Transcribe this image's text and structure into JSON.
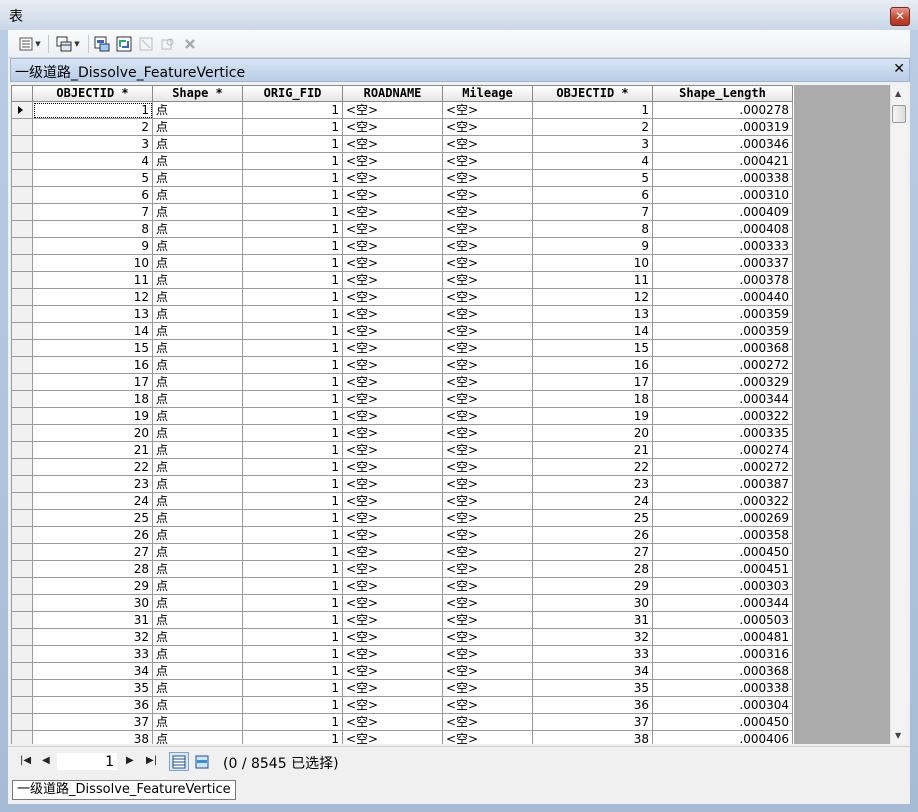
{
  "window": {
    "title": "表"
  },
  "toolbar": {
    "buttons": [
      "table-options-icon",
      "related-tables-icon",
      "select-by-attributes-icon",
      "switch-selection-icon",
      "clear-selection-icon",
      "zoom-to-selected-icon",
      "delete-selected-icon"
    ]
  },
  "table": {
    "caption": "一级道路_Dissolve_FeatureVertice",
    "columns": [
      "OBJECTID *",
      "Shape *",
      "ORIG_FID",
      "ROADNAME",
      "Mileage",
      "OBJECTID *",
      "Shape_Length"
    ],
    "rows": [
      [
        "1",
        "点",
        "1",
        "<空>",
        "<空>",
        "1",
        ".000278"
      ],
      [
        "2",
        "点",
        "1",
        "<空>",
        "<空>",
        "2",
        ".000319"
      ],
      [
        "3",
        "点",
        "1",
        "<空>",
        "<空>",
        "3",
        ".000346"
      ],
      [
        "4",
        "点",
        "1",
        "<空>",
        "<空>",
        "4",
        ".000421"
      ],
      [
        "5",
        "点",
        "1",
        "<空>",
        "<空>",
        "5",
        ".000338"
      ],
      [
        "6",
        "点",
        "1",
        "<空>",
        "<空>",
        "6",
        ".000310"
      ],
      [
        "7",
        "点",
        "1",
        "<空>",
        "<空>",
        "7",
        ".000409"
      ],
      [
        "8",
        "点",
        "1",
        "<空>",
        "<空>",
        "8",
        ".000408"
      ],
      [
        "9",
        "点",
        "1",
        "<空>",
        "<空>",
        "9",
        ".000333"
      ],
      [
        "10",
        "点",
        "1",
        "<空>",
        "<空>",
        "10",
        ".000337"
      ],
      [
        "11",
        "点",
        "1",
        "<空>",
        "<空>",
        "11",
        ".000378"
      ],
      [
        "12",
        "点",
        "1",
        "<空>",
        "<空>",
        "12",
        ".000440"
      ],
      [
        "13",
        "点",
        "1",
        "<空>",
        "<空>",
        "13",
        ".000359"
      ],
      [
        "14",
        "点",
        "1",
        "<空>",
        "<空>",
        "14",
        ".000359"
      ],
      [
        "15",
        "点",
        "1",
        "<空>",
        "<空>",
        "15",
        ".000368"
      ],
      [
        "16",
        "点",
        "1",
        "<空>",
        "<空>",
        "16",
        ".000272"
      ],
      [
        "17",
        "点",
        "1",
        "<空>",
        "<空>",
        "17",
        ".000329"
      ],
      [
        "18",
        "点",
        "1",
        "<空>",
        "<空>",
        "18",
        ".000344"
      ],
      [
        "19",
        "点",
        "1",
        "<空>",
        "<空>",
        "19",
        ".000322"
      ],
      [
        "20",
        "点",
        "1",
        "<空>",
        "<空>",
        "20",
        ".000335"
      ],
      [
        "21",
        "点",
        "1",
        "<空>",
        "<空>",
        "21",
        ".000274"
      ],
      [
        "22",
        "点",
        "1",
        "<空>",
        "<空>",
        "22",
        ".000272"
      ],
      [
        "23",
        "点",
        "1",
        "<空>",
        "<空>",
        "23",
        ".000387"
      ],
      [
        "24",
        "点",
        "1",
        "<空>",
        "<空>",
        "24",
        ".000322"
      ],
      [
        "25",
        "点",
        "1",
        "<空>",
        "<空>",
        "25",
        ".000269"
      ],
      [
        "26",
        "点",
        "1",
        "<空>",
        "<空>",
        "26",
        ".000358"
      ],
      [
        "27",
        "点",
        "1",
        "<空>",
        "<空>",
        "27",
        ".000450"
      ],
      [
        "28",
        "点",
        "1",
        "<空>",
        "<空>",
        "28",
        ".000451"
      ],
      [
        "29",
        "点",
        "1",
        "<空>",
        "<空>",
        "29",
        ".000303"
      ],
      [
        "30",
        "点",
        "1",
        "<空>",
        "<空>",
        "30",
        ".000344"
      ],
      [
        "31",
        "点",
        "1",
        "<空>",
        "<空>",
        "31",
        ".000503"
      ],
      [
        "32",
        "点",
        "1",
        "<空>",
        "<空>",
        "32",
        ".000481"
      ],
      [
        "33",
        "点",
        "1",
        "<空>",
        "<空>",
        "33",
        ".000316"
      ],
      [
        "34",
        "点",
        "1",
        "<空>",
        "<空>",
        "34",
        ".000368"
      ],
      [
        "35",
        "点",
        "1",
        "<空>",
        "<空>",
        "35",
        ".000338"
      ],
      [
        "36",
        "点",
        "1",
        "<空>",
        "<空>",
        "36",
        ".000304"
      ],
      [
        "37",
        "点",
        "1",
        "<空>",
        "<空>",
        "37",
        ".000450"
      ],
      [
        "38",
        "点",
        "1",
        "<空>",
        "<空>",
        "38",
        ".000406"
      ]
    ]
  },
  "navigation": {
    "current_record": "1",
    "selection_status": "(0 / 8545 已选择)"
  },
  "tabs": [
    "一级道路_Dissolve_FeatureVertice"
  ]
}
